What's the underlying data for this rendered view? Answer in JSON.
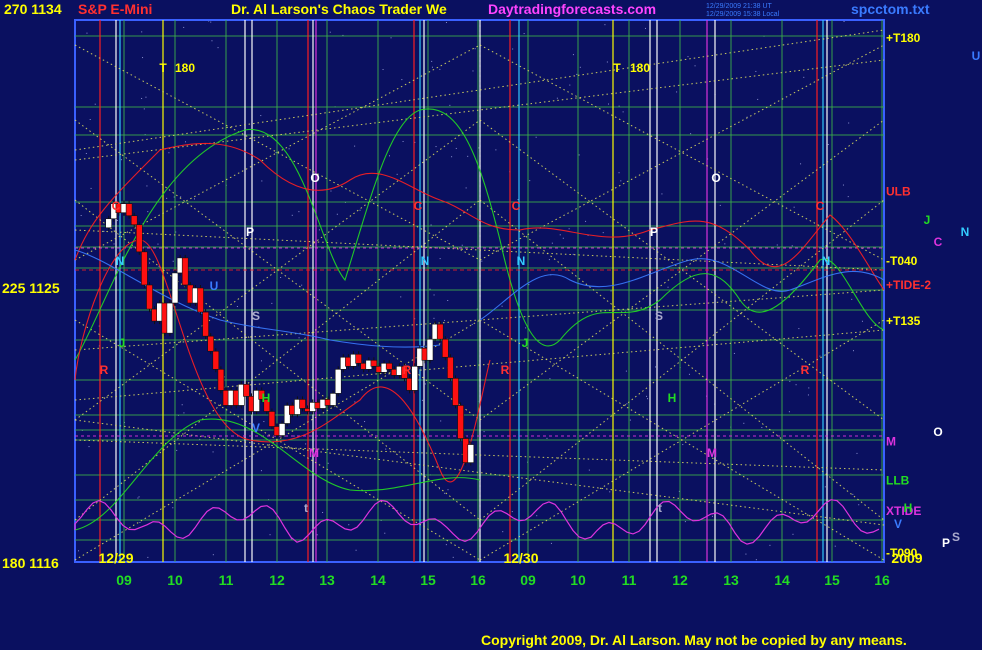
{
  "header": {
    "top_left": "270  1134",
    "symbol": "S&P E-Mini",
    "title": "Dr. Al Larson's Chaos Trader We",
    "site": "Daytradingforecasts.com",
    "stamp1": "12/29/2009 21:38 UT",
    "stamp2": "12/29/2009 15:38 Local",
    "file": "spcctom.txt"
  },
  "left_axis": [
    {
      "label": "270  1134"
    },
    {
      "label": "225  1125"
    },
    {
      "label": "180  1116"
    }
  ],
  "copyright": "Copyright 2009, Dr. Al Larson. May not be copied by any means.",
  "colors": {
    "background": "#0a1060",
    "plot_border": "#3a60ff",
    "grid": "#3cb04a",
    "yellow": "#ffff00",
    "red": "#ff2020",
    "green": "#22dd22",
    "magenta": "#dd33dd",
    "cyan": "#33ccff",
    "white": "#ffffff"
  },
  "chart_data": {
    "type": "candlestick",
    "title": "S&P E-Mini",
    "x_axis": {
      "day_labels": [
        "12/29",
        "12/30"
      ],
      "hour_labels": [
        "09",
        "10",
        "11",
        "12",
        "13",
        "14",
        "15",
        "16",
        "09",
        "10",
        "11",
        "12",
        "13",
        "14",
        "15",
        "16"
      ],
      "year_label": "2009"
    },
    "y_axis": {
      "range": [
        1116,
        1134
      ],
      "tick_labels": [
        "1134",
        "1125",
        "1116"
      ],
      "secondary_tick_labels": [
        "270",
        "225",
        "180"
      ]
    },
    "price_bars": [
      {
        "t": 8.7,
        "o": 1127.1,
        "c": 1127.4
      },
      {
        "t": 8.8,
        "o": 1127.4,
        "c": 1127.9
      },
      {
        "t": 8.9,
        "o": 1127.9,
        "c": 1127.6
      },
      {
        "t": 9.0,
        "o": 1127.6,
        "c": 1127.9
      },
      {
        "t": 9.1,
        "o": 1127.9,
        "c": 1127.5
      },
      {
        "t": 9.2,
        "o": 1127.5,
        "c": 1127.2
      },
      {
        "t": 9.3,
        "o": 1127.2,
        "c": 1126.3
      },
      {
        "t": 9.4,
        "o": 1126.3,
        "c": 1125.2
      },
      {
        "t": 9.5,
        "o": 1125.2,
        "c": 1124.4
      },
      {
        "t": 9.6,
        "o": 1124.4,
        "c": 1124.0
      },
      {
        "t": 9.7,
        "o": 1124.0,
        "c": 1124.6
      },
      {
        "t": 9.8,
        "o": 1124.6,
        "c": 1123.6
      },
      {
        "t": 9.9,
        "o": 1123.6,
        "c": 1124.6
      },
      {
        "t": 10.0,
        "o": 1124.6,
        "c": 1125.6
      },
      {
        "t": 10.1,
        "o": 1125.6,
        "c": 1126.1
      },
      {
        "t": 10.2,
        "o": 1126.1,
        "c": 1125.2
      },
      {
        "t": 10.3,
        "o": 1125.2,
        "c": 1124.6
      },
      {
        "t": 10.4,
        "o": 1124.6,
        "c": 1125.1
      },
      {
        "t": 10.5,
        "o": 1125.1,
        "c": 1124.3
      },
      {
        "t": 10.6,
        "o": 1124.3,
        "c": 1123.5
      },
      {
        "t": 10.7,
        "o": 1123.5,
        "c": 1123.0
      },
      {
        "t": 10.8,
        "o": 1123.0,
        "c": 1122.4
      },
      {
        "t": 10.9,
        "o": 1122.4,
        "c": 1121.7
      },
      {
        "t": 11.0,
        "o": 1121.7,
        "c": 1121.2
      },
      {
        "t": 11.1,
        "o": 1121.2,
        "c": 1121.7
      },
      {
        "t": 11.2,
        "o": 1121.7,
        "c": 1121.2
      },
      {
        "t": 11.3,
        "o": 1121.2,
        "c": 1121.9
      },
      {
        "t": 11.4,
        "o": 1121.9,
        "c": 1121.5
      },
      {
        "t": 11.5,
        "o": 1121.5,
        "c": 1121.0
      },
      {
        "t": 11.6,
        "o": 1121.0,
        "c": 1121.7
      },
      {
        "t": 11.7,
        "o": 1121.7,
        "c": 1121.4
      },
      {
        "t": 11.8,
        "o": 1121.4,
        "c": 1121.0
      },
      {
        "t": 11.9,
        "o": 1121.0,
        "c": 1120.5
      },
      {
        "t": 12.0,
        "o": 1120.5,
        "c": 1120.2
      },
      {
        "t": 12.1,
        "o": 1120.2,
        "c": 1120.6
      },
      {
        "t": 12.2,
        "o": 1120.6,
        "c": 1121.2
      },
      {
        "t": 12.3,
        "o": 1121.2,
        "c": 1120.9
      },
      {
        "t": 12.4,
        "o": 1120.9,
        "c": 1121.4
      },
      {
        "t": 12.5,
        "o": 1121.4,
        "c": 1121.1
      },
      {
        "t": 12.6,
        "o": 1121.1,
        "c": 1121.0
      },
      {
        "t": 12.7,
        "o": 1121.0,
        "c": 1121.3
      },
      {
        "t": 12.8,
        "o": 1121.3,
        "c": 1121.1
      },
      {
        "t": 12.9,
        "o": 1121.1,
        "c": 1121.4
      },
      {
        "t": 13.0,
        "o": 1121.4,
        "c": 1121.2
      },
      {
        "t": 13.1,
        "o": 1121.2,
        "c": 1121.6
      },
      {
        "t": 13.2,
        "o": 1121.6,
        "c": 1122.4
      },
      {
        "t": 13.3,
        "o": 1122.4,
        "c": 1122.8
      },
      {
        "t": 13.4,
        "o": 1122.8,
        "c": 1122.5
      },
      {
        "t": 13.5,
        "o": 1122.5,
        "c": 1122.9
      },
      {
        "t": 13.6,
        "o": 1122.9,
        "c": 1122.6
      },
      {
        "t": 13.7,
        "o": 1122.6,
        "c": 1122.4
      },
      {
        "t": 13.8,
        "o": 1122.4,
        "c": 1122.7
      },
      {
        "t": 13.9,
        "o": 1122.7,
        "c": 1122.5
      },
      {
        "t": 14.0,
        "o": 1122.5,
        "c": 1122.3
      },
      {
        "t": 14.1,
        "o": 1122.3,
        "c": 1122.6
      },
      {
        "t": 14.2,
        "o": 1122.6,
        "c": 1122.4
      },
      {
        "t": 14.3,
        "o": 1122.4,
        "c": 1122.2
      },
      {
        "t": 14.4,
        "o": 1122.2,
        "c": 1122.5
      },
      {
        "t": 14.5,
        "o": 1122.5,
        "c": 1122.1
      },
      {
        "t": 14.6,
        "o": 1122.1,
        "c": 1121.7
      },
      {
        "t": 14.7,
        "o": 1121.7,
        "c": 1122.5
      },
      {
        "t": 14.8,
        "o": 1122.5,
        "c": 1123.1
      },
      {
        "t": 14.9,
        "o": 1123.1,
        "c": 1122.7
      },
      {
        "t": 15.0,
        "o": 1122.7,
        "c": 1123.4
      },
      {
        "t": 15.1,
        "o": 1123.4,
        "c": 1123.9
      },
      {
        "t": 15.2,
        "o": 1123.9,
        "c": 1123.4
      },
      {
        "t": 15.3,
        "o": 1123.4,
        "c": 1122.8
      },
      {
        "t": 15.4,
        "o": 1122.8,
        "c": 1122.1
      },
      {
        "t": 15.5,
        "o": 1122.1,
        "c": 1121.2
      },
      {
        "t": 15.6,
        "o": 1121.2,
        "c": 1120.1
      },
      {
        "t": 15.7,
        "o": 1120.1,
        "c": 1119.3
      },
      {
        "t": 15.8,
        "o": 1119.3,
        "c": 1119.9
      }
    ],
    "right_labels": [
      {
        "text": "+T180",
        "y": 1133.4,
        "color": "#ffff00"
      },
      {
        "text": "ULB",
        "y": 1128.3,
        "color": "#ff3030"
      },
      {
        "text": "-T040",
        "y": 1126.0,
        "color": "#ffff00"
      },
      {
        "text": "+TIDE-2",
        "y": 1125.2,
        "color": "#ff3030"
      },
      {
        "text": "+T135",
        "y": 1124.0,
        "color": "#ffff00"
      },
      {
        "text": "M",
        "y": 1120.0,
        "color": "#dd33dd"
      },
      {
        "text": "LLB",
        "y": 1118.7,
        "color": "#22dd22"
      },
      {
        "text": "XTIDE",
        "y": 1117.7,
        "color": "#dd33dd"
      },
      {
        "text": "-T090",
        "y": 1116.3,
        "color": "#ffff00"
      }
    ],
    "outside_right_labels": [
      {
        "text": "U",
        "color": "#3a7bff"
      },
      {
        "text": "J",
        "color": "#22dd22"
      },
      {
        "text": "C",
        "color": "#dd33dd"
      },
      {
        "text": "N",
        "color": "#33ccff"
      },
      {
        "text": "O",
        "color": "#ffffff"
      },
      {
        "text": "H",
        "color": "#22dd22"
      },
      {
        "text": "V",
        "color": "#3a7bff"
      },
      {
        "text": "P",
        "color": "#ffffff"
      },
      {
        "text": "S",
        "color": "#aaaacc"
      }
    ],
    "planet_markers": [
      {
        "text": "T",
        "color": "#ffff00"
      },
      {
        "text": "180",
        "color": "#ffff00"
      },
      {
        "text": "C",
        "color": "#ff3030"
      },
      {
        "text": "N",
        "color": "#33ccff"
      },
      {
        "text": "U",
        "color": "#3a7bff"
      },
      {
        "text": "P",
        "color": "#ffffff"
      },
      {
        "text": "S",
        "color": "#aaaacc"
      },
      {
        "text": "J",
        "color": "#22dd22"
      },
      {
        "text": "R",
        "color": "#ff3030"
      },
      {
        "text": "H",
        "color": "#22dd22"
      },
      {
        "text": "M",
        "color": "#dd33dd"
      },
      {
        "text": "O",
        "color": "#ffffff"
      },
      {
        "text": "C",
        "color": "#ff3030"
      },
      {
        "text": "N",
        "color": "#33ccff"
      },
      {
        "text": "R",
        "color": "#ff3030"
      },
      {
        "text": "t",
        "color": "#aaaacc"
      },
      {
        "text": "T",
        "color": "#ffff00"
      },
      {
        "text": "180",
        "color": "#ffff00"
      },
      {
        "text": "C",
        "color": "#ff3030"
      },
      {
        "text": "N",
        "color": "#33ccff"
      },
      {
        "text": "P",
        "color": "#ffffff"
      },
      {
        "text": "S",
        "color": "#aaaacc"
      },
      {
        "text": "J",
        "color": "#22dd22"
      },
      {
        "text": "R",
        "color": "#ff3030"
      },
      {
        "text": "H",
        "color": "#22dd22"
      },
      {
        "text": "M",
        "color": "#dd33dd"
      },
      {
        "text": "O",
        "color": "#ffffff"
      },
      {
        "text": "C",
        "color": "#ff3030"
      },
      {
        "text": "N",
        "color": "#33ccff"
      },
      {
        "text": "R",
        "color": "#ff3030"
      },
      {
        "text": "t",
        "color": "#aaaacc"
      },
      {
        "text": "V",
        "color": "#3a7bff"
      }
    ]
  }
}
